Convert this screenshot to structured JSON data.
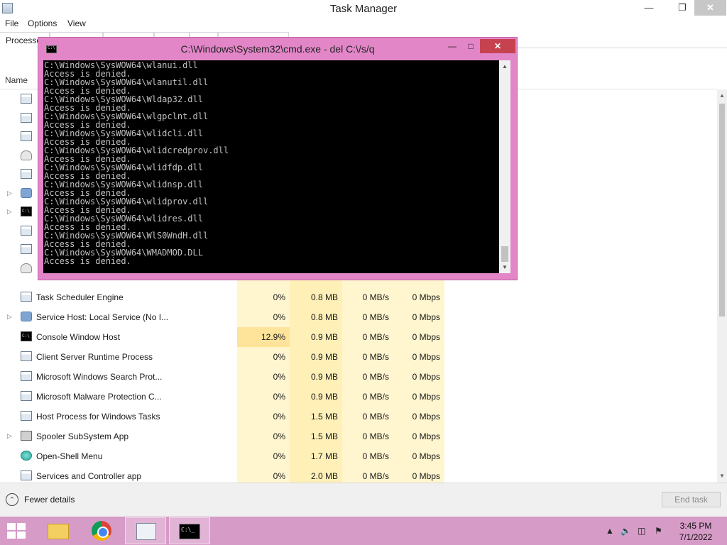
{
  "task_manager": {
    "title": "Task Manager",
    "menu": [
      "File",
      "Options",
      "View"
    ],
    "tabs": [
      "Processes",
      "",
      "",
      "",
      "",
      ""
    ],
    "column_name": "Name",
    "processes": [
      {
        "name": "Task Scheduler Engine",
        "icon": "window-icon",
        "arrow": false,
        "cpu": "0%",
        "mem": "0.8 MB",
        "disk": "0 MB/s",
        "net": "0 Mbps"
      },
      {
        "name": "Service Host: Local Service (No I...",
        "icon": "gear-icon",
        "arrow": true,
        "cpu": "0%",
        "mem": "0.8 MB",
        "disk": "0 MB/s",
        "net": "0 Mbps"
      },
      {
        "name": "Console Window Host",
        "icon": "console-icon",
        "arrow": false,
        "cpu": "12.9%",
        "mem": "0.9 MB",
        "disk": "0 MB/s",
        "net": "0 Mbps",
        "hot": true
      },
      {
        "name": "Client Server Runtime Process",
        "icon": "window-icon",
        "arrow": false,
        "cpu": "0%",
        "mem": "0.9 MB",
        "disk": "0 MB/s",
        "net": "0 Mbps"
      },
      {
        "name": "Microsoft Windows Search Prot...",
        "icon": "window-icon",
        "arrow": false,
        "cpu": "0%",
        "mem": "0.9 MB",
        "disk": "0 MB/s",
        "net": "0 Mbps"
      },
      {
        "name": "Microsoft Malware Protection C...",
        "icon": "window-icon",
        "arrow": false,
        "cpu": "0%",
        "mem": "0.9 MB",
        "disk": "0 MB/s",
        "net": "0 Mbps"
      },
      {
        "name": "Host Process for Windows Tasks",
        "icon": "window-icon",
        "arrow": false,
        "cpu": "0%",
        "mem": "1.5 MB",
        "disk": "0 MB/s",
        "net": "0 Mbps"
      },
      {
        "name": "Spooler SubSystem App",
        "icon": "printer-icon",
        "arrow": true,
        "cpu": "0%",
        "mem": "1.5 MB",
        "disk": "0 MB/s",
        "net": "0 Mbps"
      },
      {
        "name": "Open-Shell Menu",
        "icon": "shell-icon",
        "arrow": false,
        "cpu": "0%",
        "mem": "1.7 MB",
        "disk": "0 MB/s",
        "net": "0 Mbps"
      },
      {
        "name": "Services and Controller app",
        "icon": "window-icon",
        "arrow": false,
        "cpu": "0%",
        "mem": "2.0 MB",
        "disk": "0 MB/s",
        "net": "0 Mbps"
      }
    ],
    "hidden_rows_icons": [
      "window-icon",
      "window-icon",
      "window-icon",
      "shield-icon",
      "window-icon",
      "gear-icon",
      "console-icon",
      "window-icon",
      "window-icon",
      "user-icon"
    ],
    "fewer_details": "Fewer details",
    "end_task": "End task"
  },
  "cmd": {
    "title": "C:\\Windows\\System32\\cmd.exe - del  C:\\/s/q",
    "lines": [
      "C:\\Windows\\SysWOW64\\wlanui.dll",
      "Access is denied.",
      "C:\\Windows\\SysWOW64\\wlanutil.dll",
      "Access is denied.",
      "C:\\Windows\\SysWOW64\\Wldap32.dll",
      "Access is denied.",
      "C:\\Windows\\SysWOW64\\wlgpclnt.dll",
      "Access is denied.",
      "C:\\Windows\\SysWOW64\\wlidcli.dll",
      "Access is denied.",
      "C:\\Windows\\SysWOW64\\wlidcredprov.dll",
      "Access is denied.",
      "C:\\Windows\\SysWOW64\\wlidfdp.dll",
      "Access is denied.",
      "C:\\Windows\\SysWOW64\\wlidnsp.dll",
      "Access is denied.",
      "C:\\Windows\\SysWOW64\\wlidprov.dll",
      "Access is denied.",
      "C:\\Windows\\SysWOW64\\wlidres.dll",
      "Access is denied.",
      "C:\\Windows\\SysWOW64\\WlS0WndH.dll",
      "Access is denied.",
      "C:\\Windows\\SysWOW64\\WMADMOD.DLL",
      "Access is denied."
    ]
  },
  "taskbar": {
    "apps": [
      "file-explorer-icon",
      "chrome-icon",
      "task-manager-icon",
      "cmd-icon"
    ],
    "time": "3:45 PM",
    "date": "7/1/2022"
  },
  "colors": {
    "accent": "#d79bc8",
    "cmd_border": "#e286c8",
    "cpu_hot": "#fde49a"
  }
}
